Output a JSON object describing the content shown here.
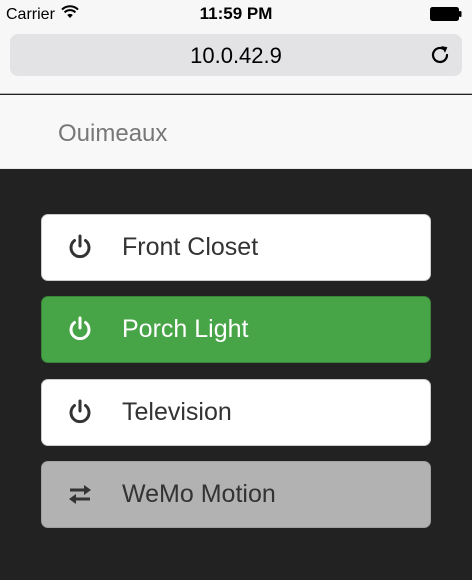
{
  "status_bar": {
    "carrier": "Carrier",
    "time": "11:59 PM"
  },
  "browser": {
    "url": "10.0.42.9"
  },
  "navbar": {
    "brand": "Ouimeaux"
  },
  "devices": [
    {
      "label": "Front Closet",
      "icon": "power-icon",
      "state": "off"
    },
    {
      "label": "Porch Light",
      "icon": "power-icon",
      "state": "on"
    },
    {
      "label": "Television",
      "icon": "power-icon",
      "state": "off"
    },
    {
      "label": "WeMo Motion",
      "icon": "swap-arrows-icon",
      "state": "motion"
    }
  ],
  "colors": {
    "on": "#47a447",
    "off": "#ffffff",
    "motion": "#b2b2b2",
    "background": "#222222"
  }
}
